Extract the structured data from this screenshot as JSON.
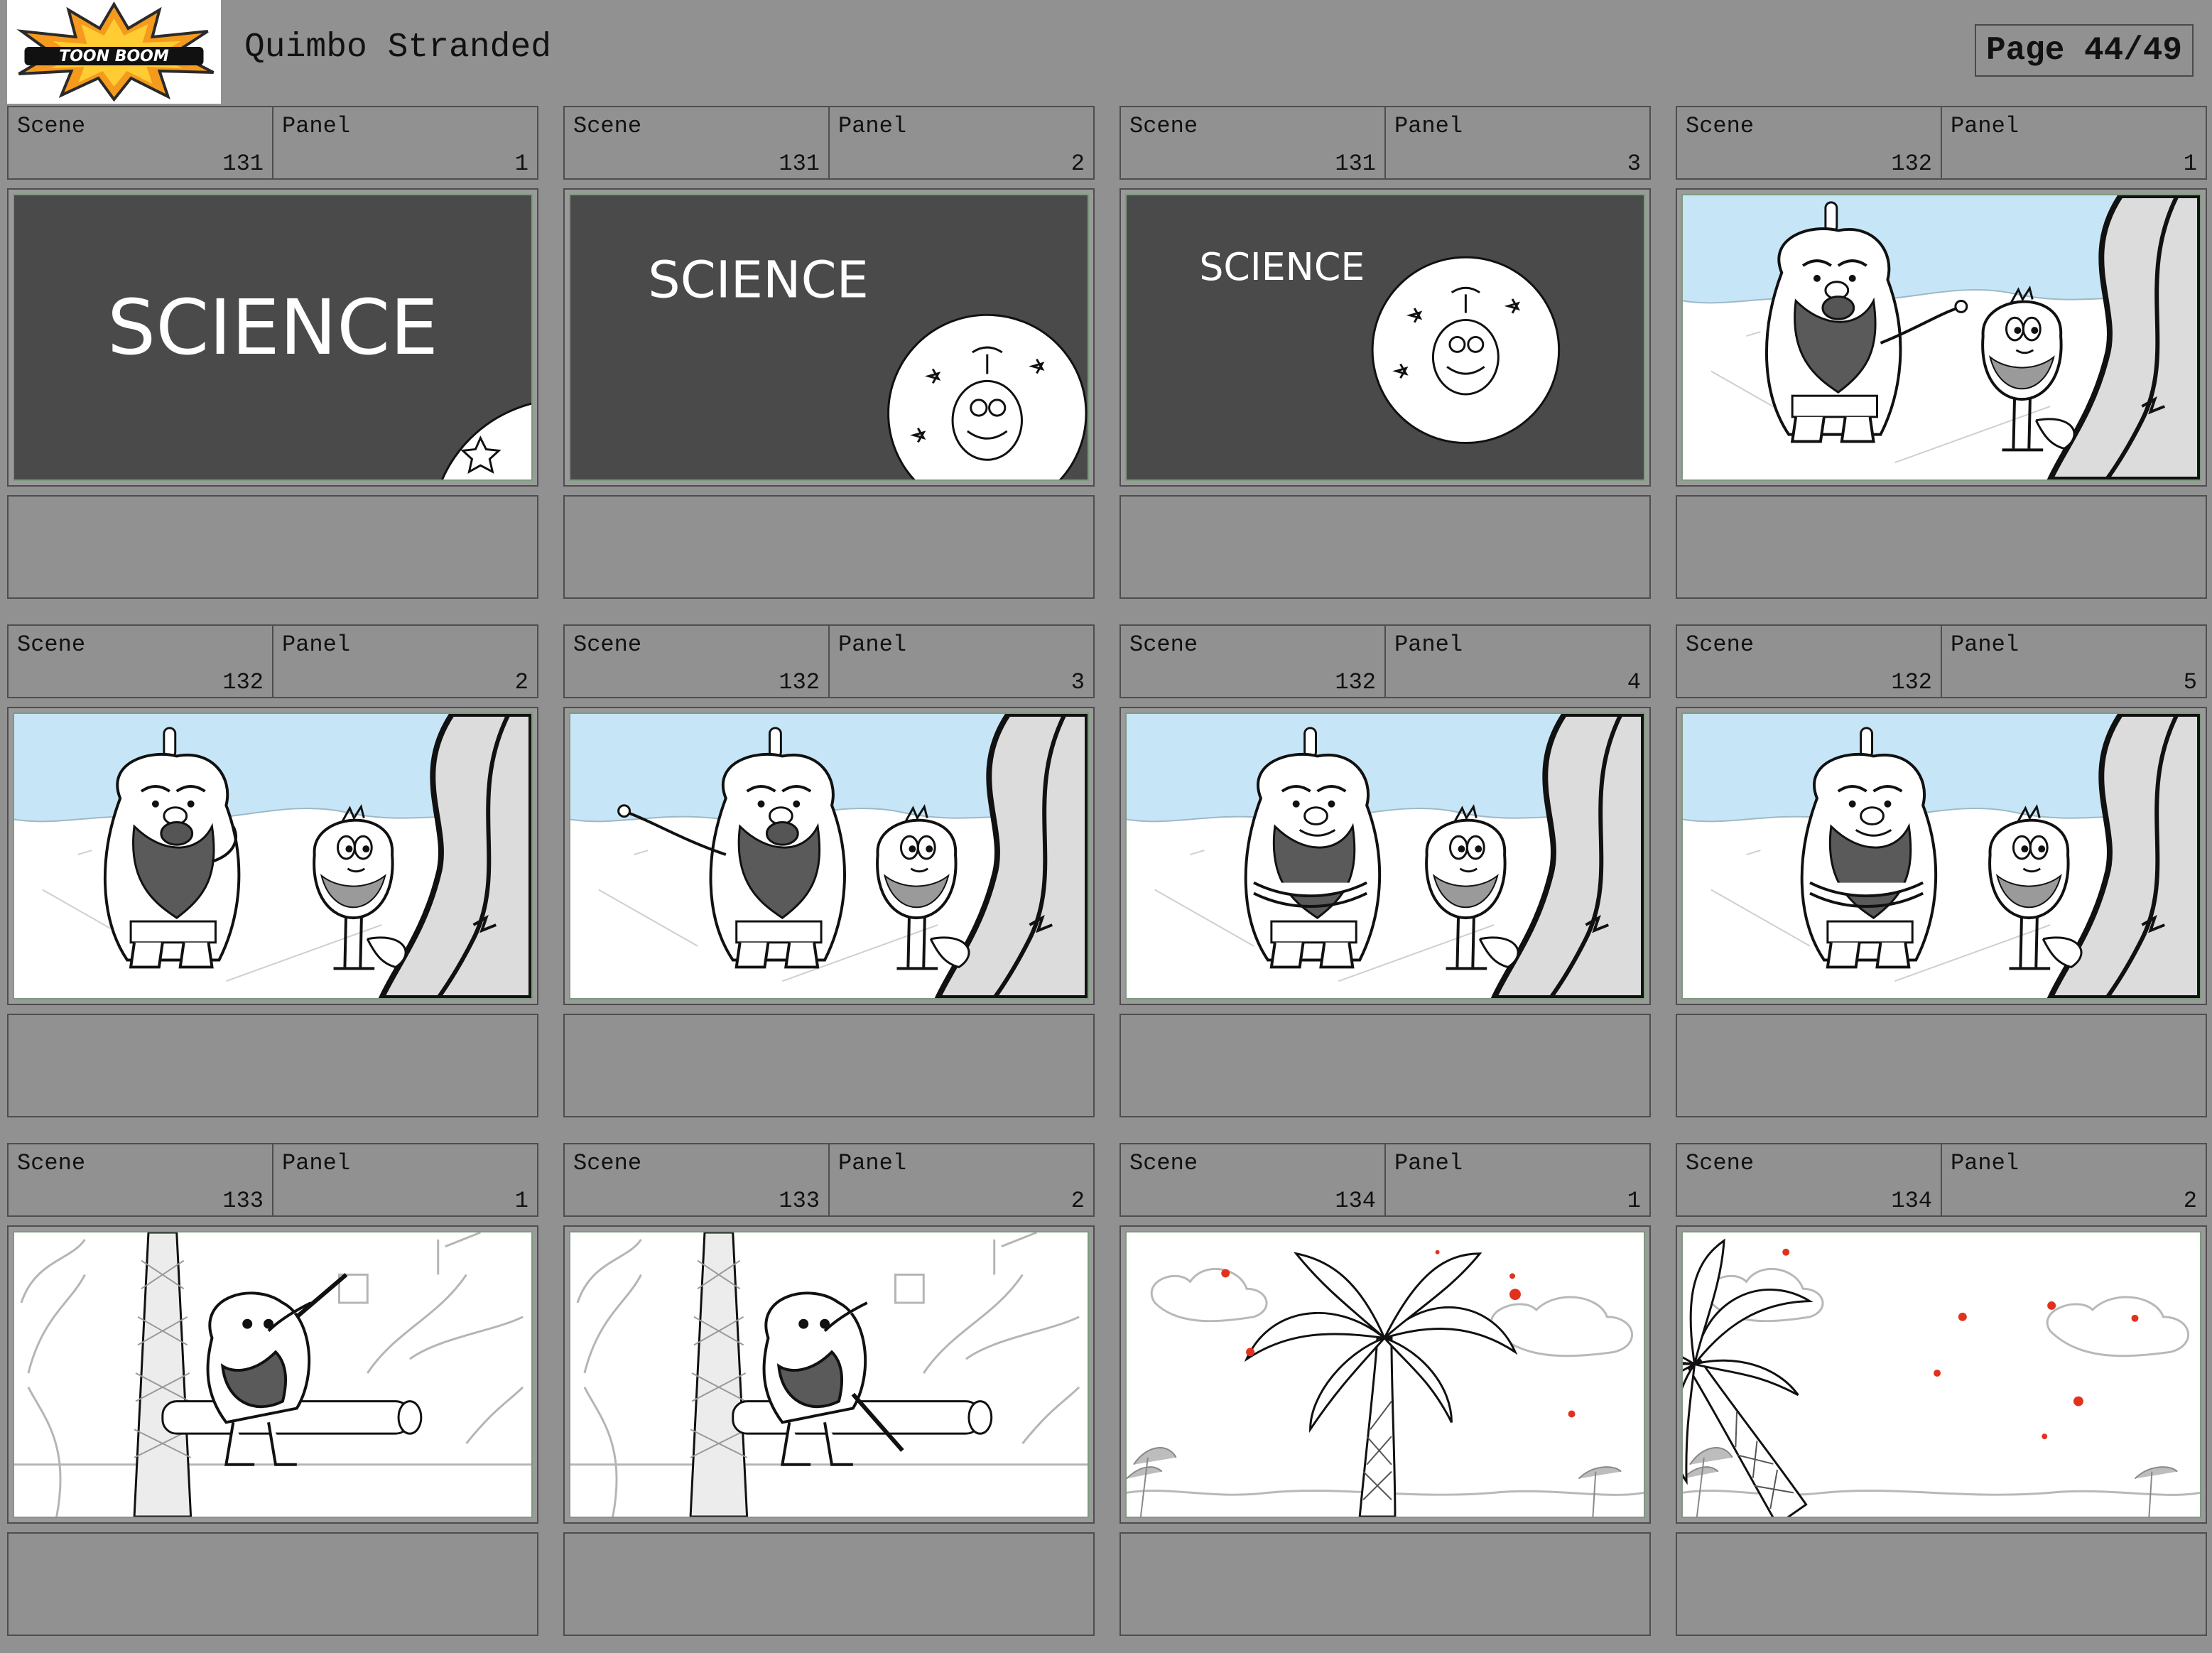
{
  "header": {
    "logo_text": "TOON BOOM",
    "title": "Quimbo Stranded",
    "page": "Page 44/49"
  },
  "labels": {
    "scene": "Scene",
    "panel": "Panel"
  },
  "panels": [
    {
      "scene": "131",
      "panel": "1",
      "image": "science-title-card"
    },
    {
      "scene": "131",
      "panel": "2",
      "image": "science-title-card-circle-zoom"
    },
    {
      "scene": "131",
      "panel": "3",
      "image": "science-title-card-circle"
    },
    {
      "scene": "132",
      "panel": "1",
      "image": "beach-big-creature-pointing"
    },
    {
      "scene": "132",
      "panel": "2",
      "image": "beach-big-creature-talking"
    },
    {
      "scene": "132",
      "panel": "3",
      "image": "beach-big-creature-pointing-left"
    },
    {
      "scene": "132",
      "panel": "4",
      "image": "beach-big-creature-arms-crossed"
    },
    {
      "scene": "132",
      "panel": "5",
      "image": "beach-big-creature-arms-crossed-smile"
    },
    {
      "scene": "133",
      "panel": "1",
      "image": "jungle-creature-holding-stick"
    },
    {
      "scene": "133",
      "panel": "2",
      "image": "jungle-creature-striking-tree"
    },
    {
      "scene": "134",
      "panel": "1",
      "image": "palm-tree-red-sparks"
    },
    {
      "scene": "134",
      "panel": "2",
      "image": "palm-tree-falling-red-sparks"
    }
  ],
  "science_text": "SCIENCE"
}
